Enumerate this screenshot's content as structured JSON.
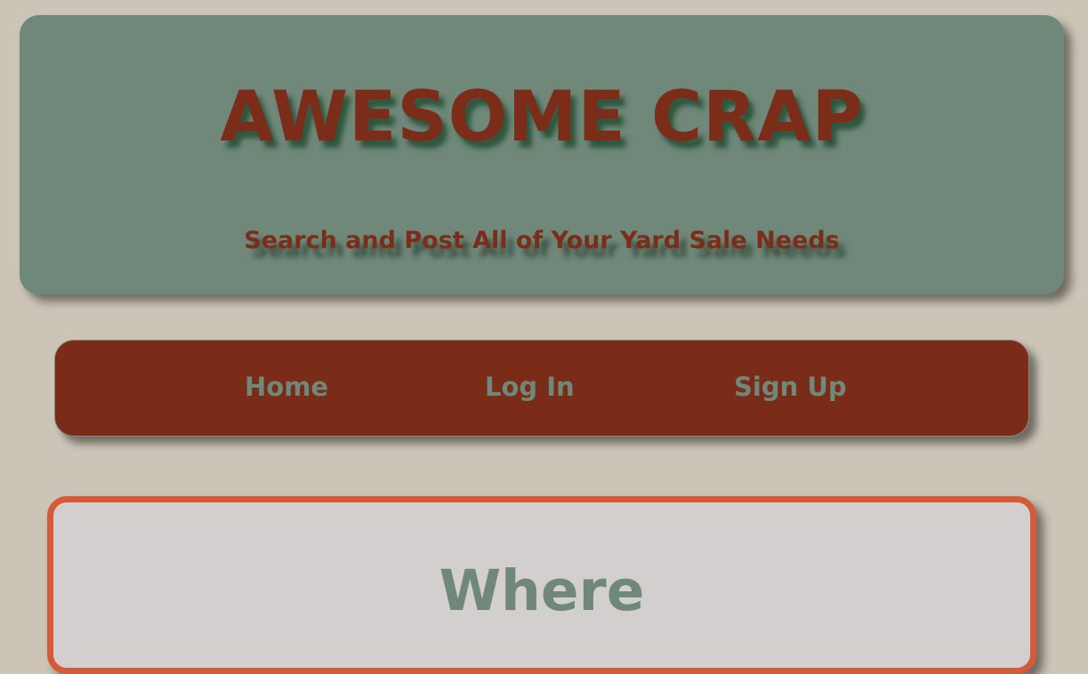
{
  "header": {
    "title": "AWESOME CRAP",
    "tagline": "Search and Post All of Your Yard Sale Needs"
  },
  "nav": {
    "items": [
      {
        "label": "Home"
      },
      {
        "label": "Log In"
      },
      {
        "label": "Sign Up"
      }
    ]
  },
  "main": {
    "heading": "Where"
  },
  "colors": {
    "background": "#cbc4b7",
    "header_bg": "#6f8879",
    "accent_red": "#7a2c18",
    "card_border": "#d55a37",
    "card_bg": "#d3cfcf"
  }
}
